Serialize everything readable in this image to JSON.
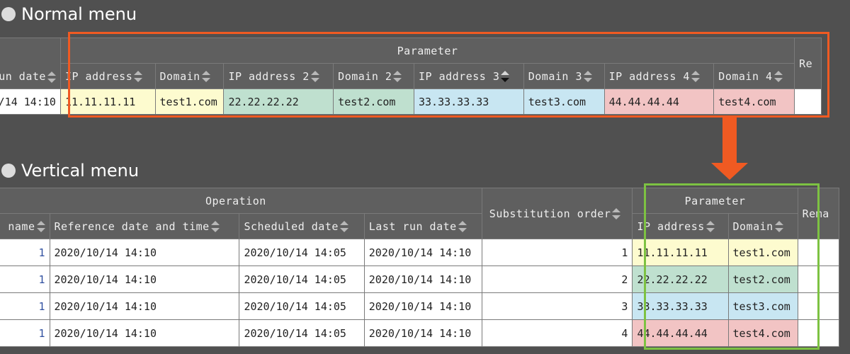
{
  "headings": {
    "normal": "Normal menu",
    "vertical": "Vertical menu"
  },
  "normal": {
    "group_header": "Parameter",
    "left_header": "un date",
    "right_header": "Re",
    "headers": [
      "IP address",
      "Domain",
      "IP address 2",
      "Domain 2",
      "IP address 3",
      "Domain 3",
      "IP address 4",
      "Domain 4"
    ],
    "row": {
      "date": "/14 14:10",
      "cells": [
        "11.11.11.11",
        "test1.com",
        "22.22.22.22",
        "test2.com",
        "33.33.33.33",
        "test3.com",
        "44.44.44.44",
        "test4.com"
      ]
    }
  },
  "vertical": {
    "operation_group": "Operation",
    "parameter_group": "Parameter",
    "substitution_header": "Substitution order",
    "remarks_header": "Rema",
    "headers": {
      "name": "name",
      "reference": "Reference date and time",
      "scheduled": "Scheduled date",
      "last_run": "Last run date",
      "ip": "IP address",
      "domain": "Domain"
    },
    "rows": [
      {
        "name": "1",
        "reference": "2020/10/14 14:10",
        "scheduled": "2020/10/14 14:05",
        "last_run": "2020/10/14 14:10",
        "order": "1",
        "ip": "11.11.11.11",
        "domain": "test1.com"
      },
      {
        "name": "1",
        "reference": "2020/10/14 14:10",
        "scheduled": "2020/10/14 14:05",
        "last_run": "2020/10/14 14:10",
        "order": "2",
        "ip": "22.22.22.22",
        "domain": "test2.com"
      },
      {
        "name": "1",
        "reference": "2020/10/14 14:10",
        "scheduled": "2020/10/14 14:05",
        "last_run": "2020/10/14 14:10",
        "order": "3",
        "ip": "33.33.33.33",
        "domain": "test3.com"
      },
      {
        "name": "1",
        "reference": "2020/10/14 14:10",
        "scheduled": "2020/10/14 14:05",
        "last_run": "2020/10/14 14:10",
        "order": "4",
        "ip": "44.44.44.44",
        "domain": "test4.com"
      }
    ]
  },
  "colors": {
    "highlight_orange": "#f05a22",
    "highlight_green": "#7dc242",
    "set1": "#fdfbcf",
    "set2": "#bfe0cf",
    "set3": "#c8e6f2",
    "set4": "#f2c4c4"
  }
}
